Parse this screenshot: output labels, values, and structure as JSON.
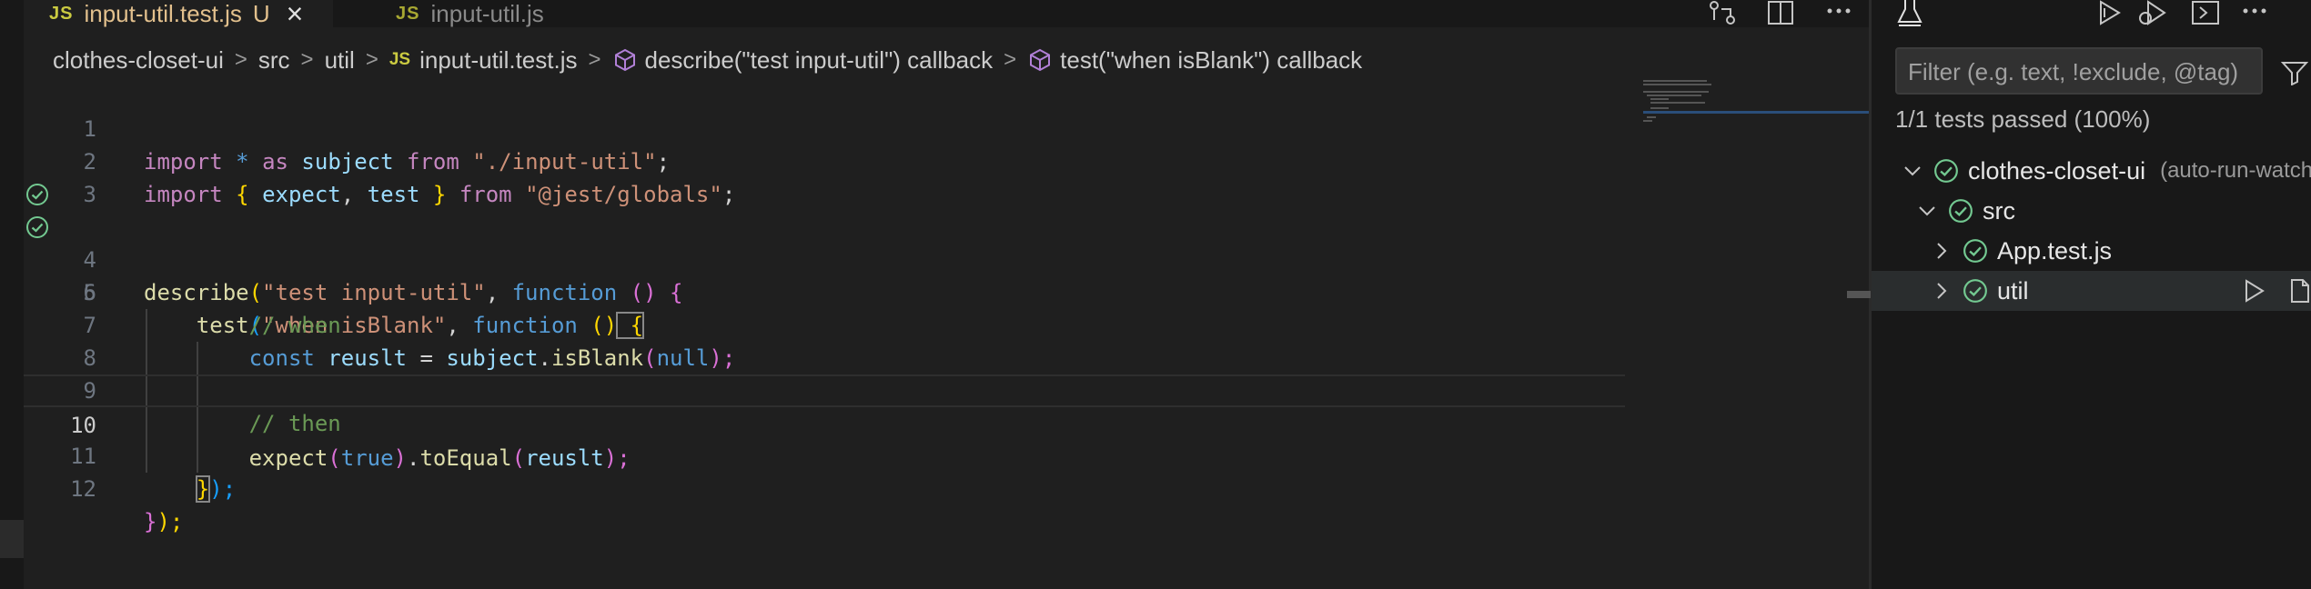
{
  "tabs": [
    {
      "icon": "JS",
      "title": "input-util.test.js",
      "modified": "U",
      "active": true
    },
    {
      "icon": "JS",
      "title": "input-util.js",
      "active": false
    }
  ],
  "breadcrumb": {
    "project": "clothes-closet-ui",
    "folder1": "src",
    "folder2": "util",
    "file_icon": "JS",
    "file": "input-util.test.js",
    "symbol1": "describe(\"test input-util\") callback",
    "symbol2": "test(\"when isBlank\") callback"
  },
  "code": {
    "current_line": 10,
    "lines": [
      {
        "n": "1",
        "status": null
      },
      {
        "n": "2",
        "status": null
      },
      {
        "n": "3",
        "status": null
      },
      {
        "n": "4",
        "status": "passed"
      },
      {
        "n": "5",
        "status": "passed"
      },
      {
        "n": "6",
        "status": null
      },
      {
        "n": "7",
        "status": null
      },
      {
        "n": "8",
        "status": null
      },
      {
        "n": "9",
        "status": null
      },
      {
        "n": "10",
        "status": null
      },
      {
        "n": "11",
        "status": null
      },
      {
        "n": "12",
        "status": null
      }
    ],
    "tokens": {
      "l1": [
        "import",
        "*",
        "as",
        "subject",
        "from",
        "\"./input-util\"",
        ";"
      ],
      "l2": [
        "import",
        "{",
        "expect",
        ",",
        "test",
        "}",
        "from",
        "\"@jest/globals\"",
        ";"
      ],
      "l4": [
        "describe",
        "(",
        "\"test input-util\"",
        ", ",
        "function",
        " ()",
        " {"
      ],
      "l5": [
        "test",
        "(",
        "\"when isBlank\"",
        ", ",
        "function",
        " ()",
        " {"
      ],
      "l6": [
        "// when"
      ],
      "l7": [
        "const",
        "reuslt",
        "=",
        "subject",
        ".",
        "isBlank",
        "(",
        "null",
        ");"
      ],
      "l9": [
        "// then"
      ],
      "l10": [
        "expect",
        "(",
        "true",
        ")",
        ".",
        "toEqual",
        "(",
        "reuslt",
        ");"
      ],
      "l11": [
        "}",
        ");"
      ],
      "l12": [
        "}",
        ");"
      ]
    }
  },
  "testing": {
    "filter_placeholder": "Filter (e.g. text, !exclude, @tag)",
    "summary": "1/1 tests passed (100%)",
    "tree": [
      {
        "label": "clothes-closet-ui",
        "desc": "(auto-run-watch)",
        "expanded": true,
        "status": "passed"
      },
      {
        "label": "src",
        "expanded": true,
        "status": "passed"
      },
      {
        "label": "App.test.js",
        "expanded": false,
        "status": "passed"
      },
      {
        "label": "util",
        "expanded": false,
        "status": "passed",
        "selected": true
      }
    ]
  },
  "colors": {
    "pass_green": "#73c991",
    "js_yellow": "#cbcb41",
    "tab_modified": "#e2c08d"
  }
}
